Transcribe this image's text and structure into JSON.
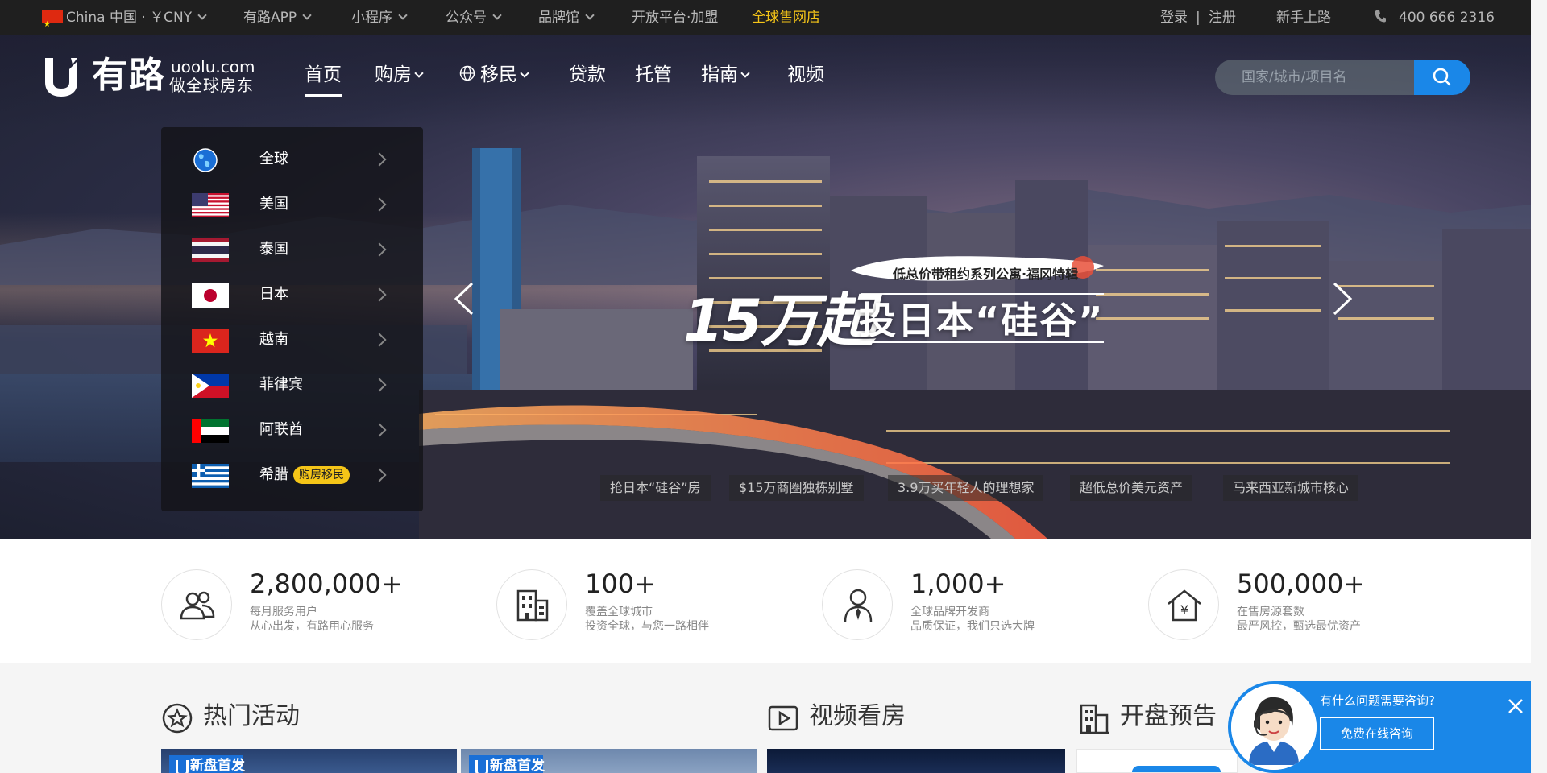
{
  "topbar": {
    "region": "China 中国 · ￥CNY",
    "app": "有路APP",
    "miniprogram": "小程序",
    "official_account": "公众号",
    "brand_hall": "品牌馆",
    "open_platform": "开放平台·加盟",
    "global_store": "全球售网店",
    "login": "登录",
    "separator": "|",
    "register": "注册",
    "beginner": "新手上路",
    "phone": "400 666 2316"
  },
  "logo": {
    "cn": "有路",
    "en": "uoolu.com",
    "slogan": "做全球房东"
  },
  "nav": {
    "items": [
      "首页",
      "购房",
      "移民",
      "贷款",
      "托管",
      "指南",
      "视频"
    ]
  },
  "search": {
    "placeholder": "国家/城市/项目名"
  },
  "dropdown": {
    "countries": [
      {
        "name": "全球",
        "icon": "globe-icon"
      },
      {
        "name": "美国",
        "icon": "flag-usa"
      },
      {
        "name": "泰国",
        "icon": "flag-thailand"
      },
      {
        "name": "日本",
        "icon": "flag-japan"
      },
      {
        "name": "越南",
        "icon": "flag-vietnam"
      },
      {
        "name": "菲律宾",
        "icon": "flag-philippines"
      },
      {
        "name": "阿联酋",
        "icon": "flag-uae"
      },
      {
        "name": "希腊",
        "icon": "flag-greece",
        "badge": "购房移民"
      }
    ]
  },
  "banner": {
    "subtitle": "低总价带租约系列公寓·福冈特辑",
    "headline_big": "15万起",
    "headline_rest": "投日本“硅谷”"
  },
  "banner_tags": [
    "抢日本“硅谷”房",
    "$15万商圈独栋别墅",
    "3.9万买年轻人的理想家",
    "超低总价美元资产",
    "马来西亚新城市核心"
  ],
  "stats": [
    {
      "num": "2,800,000+",
      "line1": "每月服务用户",
      "line2": "从心出发，有路用心服务",
      "icon": "users-icon"
    },
    {
      "num": "100+",
      "line1": "覆盖全球城市",
      "line2": "投资全球，与您一路相伴",
      "icon": "buildings-icon"
    },
    {
      "num": "1,000+",
      "line1": "全球品牌开发商",
      "line2": "品质保证，我们只选大牌",
      "icon": "businessman-icon"
    },
    {
      "num": "500,000+",
      "line1": "在售房源套数",
      "line2": "最严风控，甄选最优资产",
      "icon": "house-yen-icon"
    }
  ],
  "sections": {
    "hot_events": "热门活动",
    "video_tours": "视频看房",
    "opening_preview": "开盘预告"
  },
  "thumbs": {
    "tag": "新盘首发"
  },
  "consult": {
    "question": "有什么问题需要咨询?",
    "button": "免费在线咨询"
  },
  "colors": {
    "accent_blue": "#1a87e8",
    "accent_yellow": "#f5c518",
    "topbar_bg": "#1f1f1f"
  }
}
